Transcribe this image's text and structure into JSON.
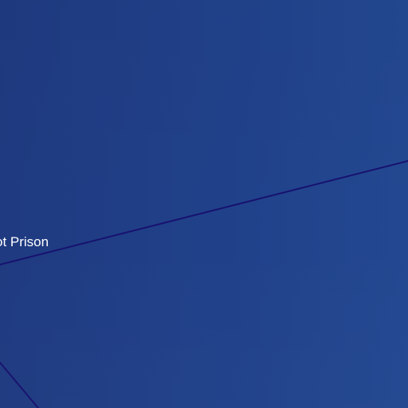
{
  "map": {
    "label": "ot Prison",
    "road_color": "#17116f",
    "background_color": "#20418a"
  }
}
